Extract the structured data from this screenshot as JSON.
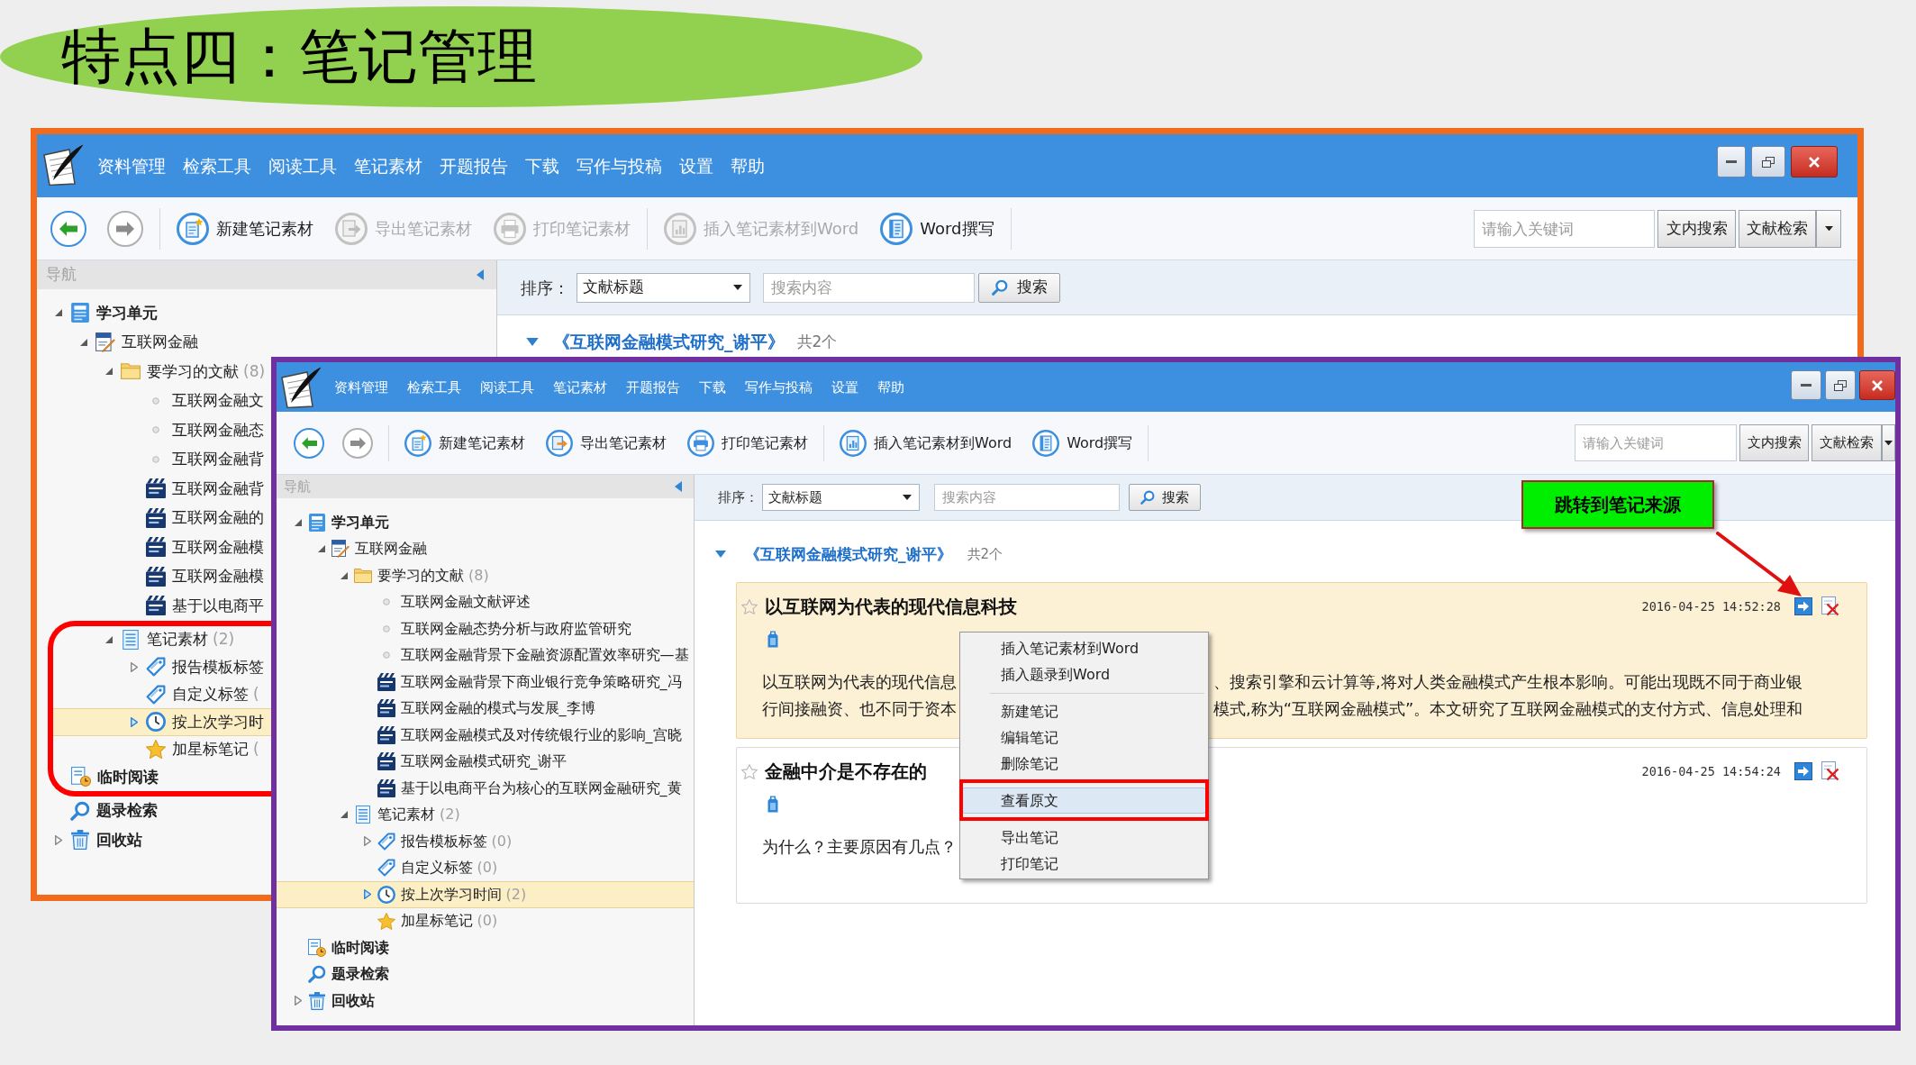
{
  "slide_title": "特点四：笔记管理",
  "back_window": {
    "menu": [
      "资料管理",
      "检索工具",
      "阅读工具",
      "笔记素材",
      "开题报告",
      "下载",
      "写作与投稿",
      "设置",
      "帮助"
    ],
    "toolbar": [
      [
        {
          "kind": "new",
          "label": "新建笔记素材",
          "disabled": false
        },
        {
          "kind": "export",
          "label": "导出笔记素材",
          "disabled": true
        },
        {
          "kind": "print",
          "label": "打印笔记素材",
          "disabled": true
        }
      ],
      [
        {
          "kind": "insert",
          "label": "插入笔记素材到Word",
          "disabled": true
        },
        {
          "kind": "write",
          "label": "Word撰写",
          "disabled": false
        }
      ]
    ],
    "search": {
      "placeholder": "请输入关键词",
      "buttons": [
        "文内搜索",
        "文献检索"
      ]
    },
    "nav_title": "导航",
    "tree": [
      {
        "label": "学习单元",
        "kind": "unit",
        "expanded": true,
        "selected": false,
        "children": [
          {
            "label": "互联网金融",
            "kind": "course",
            "expanded": true,
            "selected": false,
            "children": [
              {
                "label": "要学习的文献",
                "count": "(8)",
                "kind": "folder",
                "expanded": true,
                "selected": false,
                "children": [
                  {
                    "label": "互联网金融文",
                    "kind": "bullet",
                    "selected": false
                  },
                  {
                    "label": "互联网金融态",
                    "kind": "bullet",
                    "selected": false
                  },
                  {
                    "label": "互联网金融背",
                    "kind": "bullet",
                    "selected": false
                  },
                  {
                    "label": "互联网金融背",
                    "kind": "caj",
                    "selected": false
                  },
                  {
                    "label": "互联网金融的",
                    "kind": "caj",
                    "selected": false
                  },
                  {
                    "label": "互联网金融模",
                    "kind": "caj",
                    "selected": false
                  },
                  {
                    "label": "互联网金融模",
                    "kind": "caj",
                    "selected": false
                  },
                  {
                    "label": "基于以电商平",
                    "kind": "caj",
                    "selected": false
                  }
                ]
              },
              {
                "label": "笔记素材",
                "count": "(2)",
                "kind": "notes",
                "expanded": true,
                "selected": false,
                "children": [
                  {
                    "label": "报告模板标签",
                    "kind": "tag",
                    "expanded": false,
                    "selected": false
                  },
                  {
                    "label": "自定义标签",
                    "count": "(",
                    "kind": "tag",
                    "selected": false
                  },
                  {
                    "label": "按上次学习时",
                    "kind": "clock",
                    "expanded": false,
                    "selected": true
                  },
                  {
                    "label": "加星标笔记",
                    "count": "(",
                    "kind": "star",
                    "selected": false
                  }
                ]
              }
            ]
          }
        ]
      },
      {
        "label": "临时阅读",
        "kind": "reading",
        "selected": false
      },
      {
        "label": "题录检索",
        "kind": "search",
        "selected": false
      },
      {
        "label": "回收站",
        "kind": "trash",
        "expanded": false,
        "selected": false
      }
    ],
    "sort": {
      "label": "排序：",
      "value": "文献标题",
      "placeholder": "搜索内容",
      "button": "搜索"
    },
    "article": {
      "title": "《互联网金融模式研究_谢平》",
      "count": "共2个",
      "expanded": true
    }
  },
  "front_window": {
    "menu": [
      "资料管理",
      "检索工具",
      "阅读工具",
      "笔记素材",
      "开题报告",
      "下载",
      "写作与投稿",
      "设置",
      "帮助"
    ],
    "toolbar": [
      [
        {
          "kind": "new",
          "label": "新建笔记素材",
          "disabled": false
        },
        {
          "kind": "export",
          "label": "导出笔记素材",
          "disabled": false
        },
        {
          "kind": "print",
          "label": "打印笔记素材",
          "disabled": false
        }
      ],
      [
        {
          "kind": "insert",
          "label": "插入笔记素材到Word",
          "disabled": false
        },
        {
          "kind": "write",
          "label": "Word撰写",
          "disabled": false
        }
      ]
    ],
    "search": {
      "placeholder": "请输入关键词",
      "buttons": [
        "文内搜索",
        "文献检索"
      ]
    },
    "nav_title": "导航",
    "tree": [
      {
        "label": "学习单元",
        "kind": "unit",
        "expanded": true,
        "selected": false,
        "children": [
          {
            "label": "互联网金融",
            "kind": "course",
            "expanded": true,
            "selected": false,
            "children": [
              {
                "label": "要学习的文献",
                "count": "(8)",
                "kind": "folder",
                "expanded": true,
                "selected": false,
                "children": [
                  {
                    "label": "互联网金融文献评述",
                    "kind": "bullet",
                    "selected": false
                  },
                  {
                    "label": "互联网金融态势分析与政府监管研究",
                    "kind": "bullet",
                    "selected": false
                  },
                  {
                    "label": "互联网金融背景下金融资源配置效率研究—基",
                    "kind": "bullet",
                    "selected": false
                  },
                  {
                    "label": "互联网金融背景下商业银行竞争策略研究_冯",
                    "kind": "caj",
                    "selected": false
                  },
                  {
                    "label": "互联网金融的模式与发展_李博",
                    "kind": "caj",
                    "selected": false
                  },
                  {
                    "label": "互联网金融模式及对传统银行业的影响_宫晓",
                    "kind": "caj",
                    "selected": false
                  },
                  {
                    "label": "互联网金融模式研究_谢平",
                    "kind": "caj",
                    "selected": false
                  },
                  {
                    "label": "基于以电商平台为核心的互联网金融研究_黄",
                    "kind": "caj",
                    "selected": false
                  }
                ]
              },
              {
                "label": "笔记素材",
                "count": "(2)",
                "kind": "notes",
                "expanded": true,
                "selected": false,
                "children": [
                  {
                    "label": "报告模板标签",
                    "count": "(0)",
                    "kind": "tag",
                    "expanded": false,
                    "selected": false
                  },
                  {
                    "label": "自定义标签",
                    "count": "(0)",
                    "kind": "tag",
                    "selected": false
                  },
                  {
                    "label": "按上次学习时间",
                    "count": "(2)",
                    "kind": "clock",
                    "expanded": false,
                    "selected": true
                  },
                  {
                    "label": "加星标笔记",
                    "count": "(0)",
                    "kind": "star",
                    "selected": false
                  }
                ]
              }
            ]
          }
        ]
      },
      {
        "label": "临时阅读",
        "kind": "reading",
        "selected": false
      },
      {
        "label": "题录检索",
        "kind": "search",
        "selected": false
      },
      {
        "label": "回收站",
        "kind": "trash",
        "expanded": false,
        "selected": false
      }
    ],
    "sort": {
      "label": "排序：",
      "value": "文献标题",
      "placeholder": "搜索内容",
      "button": "搜索"
    },
    "article": {
      "title": "《互联网金融模式研究_谢平》",
      "count": "共2个",
      "expanded": true
    },
    "notes": [
      {
        "title": "以互联网为代表的现代信息科技",
        "starred": false,
        "selected": true,
        "date": "2016-04-25 14:52:28",
        "lines": [
          {
            "left": "以互联网为代表的现代信息",
            "right": "、搜索引擎和云计算等,将对人类金融模式产生根本影响。可能出现既不同于商业银"
          },
          {
            "left": "行间接融资、也不同于资本",
            "right": "模式,称为“互联网金融模式”。本文研究了互联网金融模式的支付方式、信息处理和"
          }
        ]
      },
      {
        "title": "金融中介是不存在的",
        "starred": false,
        "selected": false,
        "date": "2016-04-25 14:54:24",
        "lines": [
          {
            "left": "为什么？主要原因有几点？"
          }
        ]
      }
    ],
    "context_menu": [
      {
        "kind": "item",
        "label": "插入笔记素材到Word",
        "highlighted": false
      },
      {
        "kind": "item",
        "label": "插入题录到Word",
        "highlighted": false
      },
      {
        "kind": "separator"
      },
      {
        "kind": "item",
        "label": "新建笔记",
        "highlighted": false
      },
      {
        "kind": "item",
        "label": "编辑笔记",
        "highlighted": false
      },
      {
        "kind": "item",
        "label": "删除笔记",
        "highlighted": false
      },
      {
        "kind": "separator"
      },
      {
        "kind": "item",
        "label": "查看原文",
        "highlighted": true
      },
      {
        "kind": "separator"
      },
      {
        "kind": "item",
        "label": "导出笔记",
        "highlighted": false
      },
      {
        "kind": "item",
        "label": "打印笔记",
        "highlighted": false
      }
    ]
  },
  "callout": {
    "text": "跳转到笔记来源"
  }
}
